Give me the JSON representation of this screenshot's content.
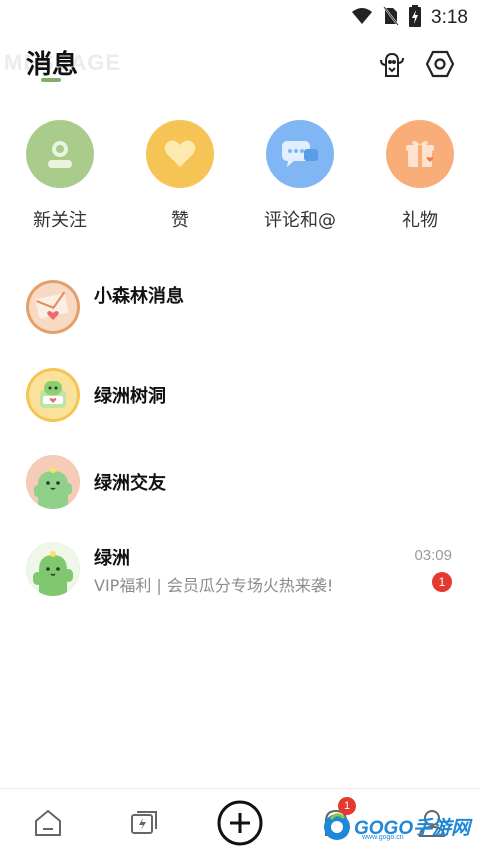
{
  "status_bar": {
    "time": "3:18",
    "icons": [
      "wifi-icon",
      "no-sim-icon",
      "battery-charging-icon"
    ]
  },
  "header": {
    "watermark": "MESSAGE",
    "title": "消息",
    "accent_color": "#7fb068",
    "actions": [
      "cactus-gift-icon",
      "settings-icon"
    ]
  },
  "quick_actions": [
    {
      "label": "新关注",
      "icon": "follow-icon",
      "color": "#a9cc8a"
    },
    {
      "label": "赞",
      "icon": "like-heart-icon",
      "color": "#f6c455"
    },
    {
      "label": "评论和@",
      "icon": "comment-icon",
      "color": "#7fb6f3"
    },
    {
      "label": "礼物",
      "icon": "gift-icon",
      "color": "#f9ae7a"
    }
  ],
  "conversations": [
    {
      "name": "小森林消息",
      "avatar_icon": "envelope-avatar-icon",
      "time": "",
      "preview": "",
      "unread": ""
    },
    {
      "name": "绿洲树洞",
      "avatar_icon": "cactus-mailbox-avatar-icon",
      "time": "",
      "preview": "",
      "unread": ""
    },
    {
      "name": "绿洲交友",
      "avatar_icon": "cactus-friend-avatar-icon",
      "time": "",
      "preview": "",
      "unread": ""
    },
    {
      "name": "绿洲",
      "avatar_icon": "cactus-avatar-icon",
      "time": "03:09",
      "preview": "VIP福利 | 会员瓜分专场火热来袭!",
      "unread": "1"
    }
  ],
  "bottom_nav": {
    "items": [
      "home-icon",
      "flash-chat-icon",
      "create-plus-icon",
      "messages-icon",
      "profile-icon"
    ],
    "messages_badge": "1",
    "watermark_text": "GOGO手游网",
    "watermark_sub": "www.gogo.cn"
  },
  "colors": {
    "unread_red": "#e5382f",
    "text_muted": "#8c8c8c"
  }
}
